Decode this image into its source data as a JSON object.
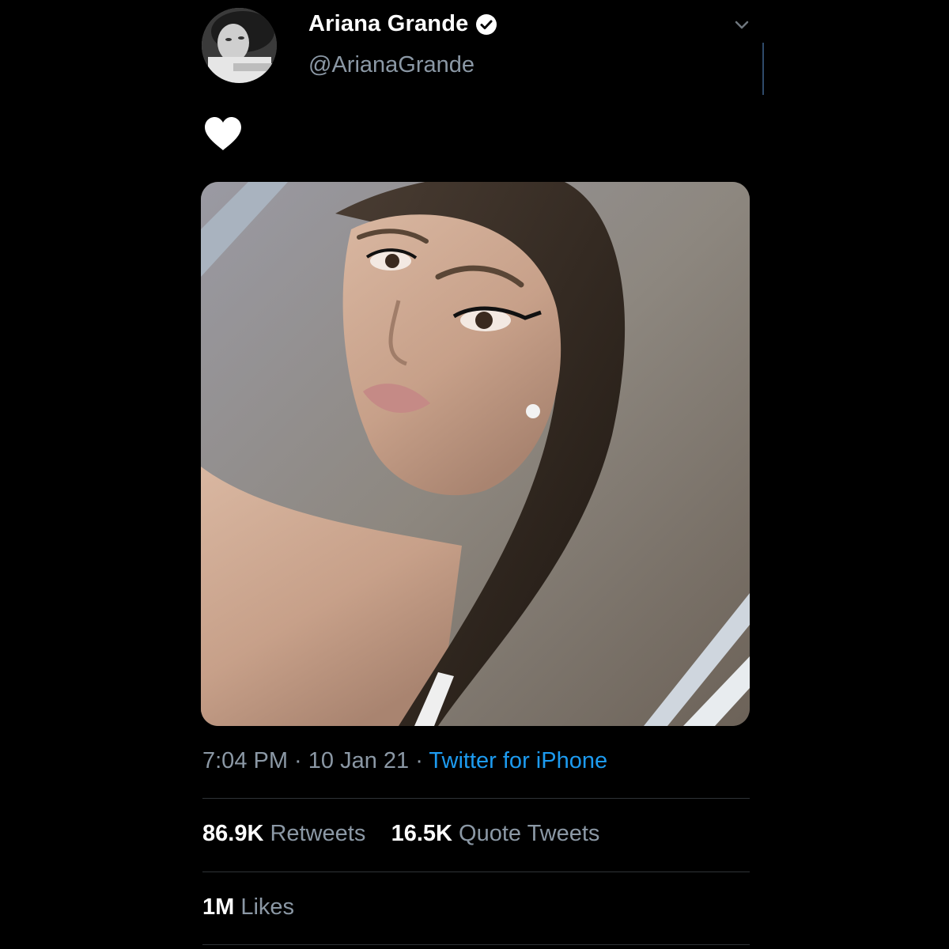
{
  "author": {
    "display_name": "Ariana Grande",
    "handle": "@ArianaGrande",
    "verified": true
  },
  "tweet": {
    "text_icon": "white-heart-icon",
    "media_description_icon": "photo"
  },
  "meta": {
    "time": "7:04 PM",
    "separator1": " · ",
    "date": "10 Jan 21",
    "separator2": " · ",
    "source": "Twitter for iPhone"
  },
  "stats": {
    "retweets_value": "86.9K",
    "retweets_label": "Retweets",
    "quotes_value": "16.5K",
    "quotes_label": "Quote Tweets",
    "likes_value": "1M",
    "likes_label": "Likes"
  },
  "colors": {
    "background": "#000000",
    "secondary_text": "#8b98a5",
    "link": "#1d9bf0",
    "divider": "#2f3336"
  }
}
